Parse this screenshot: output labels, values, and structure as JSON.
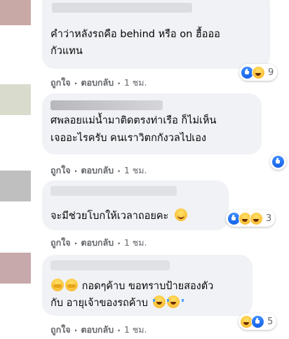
{
  "comments": [
    {
      "lines": [
        "คำว่าหลังรถคือ behind หรือ on ฮื้อออ",
        "กัวแทน"
      ],
      "actions": {
        "like": "ถูกใจ",
        "reply": "ตอบกลับ",
        "time": "1 ชม."
      },
      "reaction_count": "9",
      "reactions": [
        "like-icon",
        "haha-icon"
      ]
    },
    {
      "header_blur": "Toesa.pom.ryvm.rum",
      "lines": [
        "ศพลอยแม่น้ำมาติดตรงท่าเรือ ก็ไม่เห็น",
        "เจออะไรครับ คนเราวิตกกังวลไปเอง"
      ],
      "actions": {
        "like": "ถูกใจ",
        "reply": "ตอบกลับ",
        "time": "1 ชม."
      },
      "reactions": [
        "like-icon"
      ]
    },
    {
      "lines": [
        "จะมีช่วยโบกให้เวลาถอยคะ"
      ],
      "inline_emoji": "smile",
      "actions": {
        "like": "ถูกใจ",
        "reply": "ตอบกลับ",
        "time": "1 ชม."
      },
      "reaction_count": "3",
      "reactions": [
        "like-icon",
        "haha-icon",
        "haha-icon"
      ]
    },
    {
      "lines": [
        "กอดๆค้าบ ขอทราบป้ายสองตัว",
        "กับ อายุเจ้าของรถค้าบ"
      ],
      "actions": {
        "like": "ถูกใจ",
        "reply": "ตอบกลับ",
        "time": "1 ชม."
      },
      "reaction_count": "5",
      "reactions": [
        "haha-icon",
        "like-icon"
      ]
    }
  ],
  "colors": {
    "bubble": "#f0f2f5",
    "meta": "#65676b",
    "like_blue": "#1877f2"
  }
}
